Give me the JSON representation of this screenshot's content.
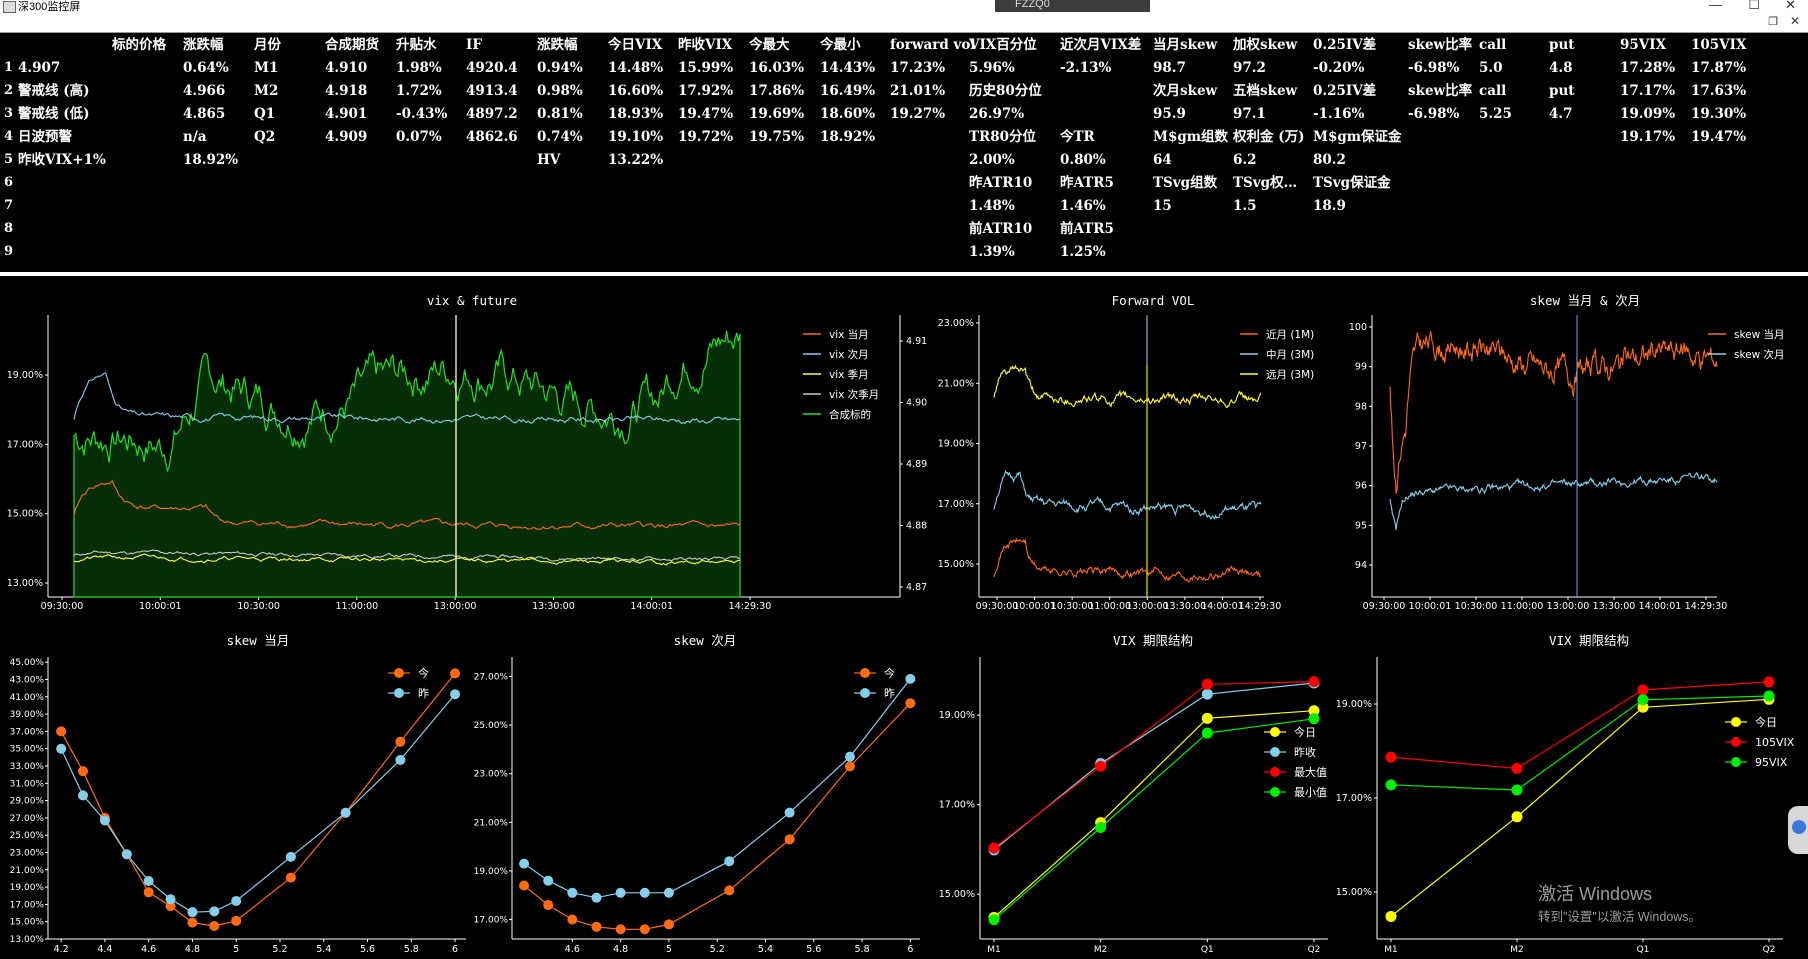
{
  "window": {
    "title": "深300监控屏",
    "ime_text": "FZZQ0"
  },
  "table": {
    "header": [
      "标的价格",
      "涨跌幅",
      "月份",
      "合成期货",
      "升贴水",
      "IF",
      "涨跌幅",
      "今日VIX",
      "昨收VIX",
      "今最大",
      "今最小",
      "forward vol",
      "VIX百分位",
      "近次月VIX差",
      "当月skew",
      "加权skew",
      "0.25IV差",
      "skew比率",
      "call",
      "put",
      "95VIX",
      "105VIX"
    ],
    "row_numbers": [
      "1",
      "2",
      "3",
      "4",
      "5",
      "6",
      "7",
      "8",
      "9"
    ],
    "rows": [
      [
        "4.907",
        "0.64%",
        "M1",
        "4.910",
        "1.98%",
        "4920.4",
        "0.94%",
        "14.48%",
        "15.99%",
        "16.03%",
        "14.43%",
        "17.23%",
        "5.96%",
        "-2.13%",
        "98.7",
        "97.2",
        "-0.20%",
        "-6.98%",
        "5.0",
        "4.8",
        "17.28%",
        "17.87%"
      ],
      [
        "警戒线 (高)",
        "4.966",
        "M2",
        "4.918",
        "1.72%",
        "4913.4",
        "0.98%",
        "16.60%",
        "17.92%",
        "17.86%",
        "16.49%",
        "21.01%",
        "历史80分位",
        "",
        "次月skew",
        "五档skew",
        "0.25IV差",
        "skew比率",
        "call",
        "put",
        "17.17%",
        "17.63%"
      ],
      [
        "警戒线 (低)",
        "4.865",
        "Q1",
        "4.901",
        "-0.43%",
        "4897.2",
        "0.81%",
        "18.93%",
        "19.47%",
        "19.69%",
        "18.60%",
        "19.27%",
        "26.97%",
        "",
        "95.9",
        "97.1",
        "-1.16%",
        "-6.98%",
        "5.25",
        "4.7",
        "19.09%",
        "19.30%"
      ],
      [
        "日波预警",
        "n/a",
        "Q2",
        "4.909",
        "0.07%",
        "4862.6",
        "0.74%",
        "19.10%",
        "19.72%",
        "19.75%",
        "18.92%",
        "",
        "TR80分位",
        "今TR",
        "M$gm组数",
        "权利金 (万)",
        "M$gm保证金",
        "",
        "",
        "",
        "19.17%",
        "19.47%"
      ],
      [
        "昨收VIX+1%",
        "18.92%",
        "",
        "",
        "",
        "",
        "HV",
        "13.22%",
        "",
        "",
        "",
        "",
        "2.00%",
        "0.80%",
        "64",
        "6.2",
        "80.2",
        "",
        "",
        "",
        "",
        ""
      ],
      [
        "",
        "",
        "",
        "",
        "",
        "",
        "",
        "",
        "",
        "",
        "",
        "",
        "昨ATR10",
        "昨ATR5",
        "TSvg组数",
        "TSvg权…",
        "TSvg保证金",
        "",
        "",
        "",
        "",
        ""
      ],
      [
        "",
        "",
        "",
        "",
        "",
        "",
        "",
        "",
        "",
        "",
        "",
        "",
        "1.48%",
        "1.46%",
        "15",
        "1.5",
        "18.9",
        "",
        "",
        "",
        "",
        ""
      ],
      [
        "",
        "",
        "",
        "",
        "",
        "",
        "",
        "",
        "",
        "",
        "",
        "",
        "前ATR10",
        "前ATR5",
        "",
        "",
        "",
        "",
        "",
        "",
        "",
        ""
      ],
      [
        "",
        "",
        "",
        "",
        "",
        "",
        "",
        "",
        "",
        "",
        "",
        "",
        "1.39%",
        "1.25%",
        "",
        "",
        "",
        "",
        "",
        "",
        "",
        ""
      ]
    ]
  },
  "charts": {
    "vix_future": {
      "title": "vix & future",
      "x_ticks": [
        "09:30:00",
        "10:00:01",
        "10:30:00",
        "11:00:00",
        "13:00:00",
        "13:30:00",
        "14:00:01",
        "14:29:30"
      ],
      "y_left_ticks": [
        "19.00%",
        "17.00%",
        "15.00%",
        "13.00%"
      ],
      "y_right_ticks": [
        "4.91",
        "4.90",
        "4.89",
        "4.88",
        "4.87"
      ],
      "legend": [
        {
          "name": "vix 当月",
          "color": "#ff6a13"
        },
        {
          "name": "vix 次月",
          "color": "#87ceeb"
        },
        {
          "name": "vix 季月",
          "color": "#ffff33"
        },
        {
          "name": "vix 次季月",
          "color": "#c8c8c8"
        },
        {
          "name": "合成标的",
          "color": "#22e022"
        }
      ]
    },
    "forward_vol": {
      "title": "Forward VOL",
      "x_ticks": [
        "09:30:00",
        "10:00:01",
        "10:30:00",
        "11:00:00",
        "13:00:00",
        "13:30:00",
        "14:00:01",
        "14:29:30"
      ],
      "y_ticks": [
        "23.00%",
        "21.00%",
        "19.00%",
        "17.00%",
        "15.00%"
      ],
      "legend": [
        {
          "name": "近月 (1M)",
          "color": "#ff6a13"
        },
        {
          "name": "中月 (3M)",
          "color": "#87ceeb"
        },
        {
          "name": "远月 (3M)",
          "color": "#ffff33"
        }
      ]
    },
    "skew_months": {
      "title": "skew 当月 & 次月",
      "x_ticks": [
        "09:30:00",
        "10:00:01",
        "10:30:00",
        "11:00:00",
        "13:00:00",
        "13:30:00",
        "14:00:01",
        "14:29:30"
      ],
      "y_ticks": [
        "100",
        "99",
        "98",
        "97",
        "96",
        "95",
        "94"
      ],
      "legend": [
        {
          "name": "skew 当月",
          "color": "#ff6a13"
        },
        {
          "name": "skew 次月",
          "color": "#87ceeb"
        }
      ]
    },
    "skew_m1": {
      "title": "skew 当月",
      "x": [
        4.2,
        4.3,
        4.4,
        4.5,
        4.6,
        4.7,
        4.8,
        4.9,
        5.0,
        5.25,
        5.5,
        5.75,
        6.0
      ],
      "x_ticks": [
        "4.2",
        "4.4",
        "4.6",
        "4.8",
        "5",
        "5.2",
        "5.4",
        "5.6",
        "5.8",
        "6"
      ],
      "y_ticks": [
        "45.00%",
        "43.00%",
        "41.00%",
        "39.00%",
        "37.00%",
        "35.00%",
        "33.00%",
        "31.00%",
        "29.00%",
        "27.00%",
        "25.00%",
        "23.00%",
        "21.00%",
        "19.00%",
        "17.00%",
        "15.00%",
        "13.00%"
      ],
      "series": [
        {
          "name": "今",
          "color": "#ff6a13",
          "values": [
            37.0,
            32.4,
            27.0,
            22.8,
            18.4,
            16.8,
            14.9,
            14.5,
            15.1,
            20.1,
            27.6,
            35.8,
            43.7
          ]
        },
        {
          "name": "昨",
          "color": "#87ceeb",
          "values": [
            35.0,
            29.6,
            26.7,
            22.8,
            19.7,
            17.6,
            16.1,
            16.2,
            17.4,
            22.5,
            27.6,
            33.7,
            41.3
          ]
        }
      ]
    },
    "skew_m2": {
      "title": "skew 次月",
      "x": [
        4.4,
        4.5,
        4.6,
        4.7,
        4.8,
        4.9,
        5.0,
        5.25,
        5.5,
        5.75,
        6.0
      ],
      "x_ticks": [
        "4.6",
        "4.8",
        "5",
        "5.2",
        "5.4",
        "5.6",
        "5.8",
        "6"
      ],
      "y_ticks": [
        "27.00%",
        "25.00%",
        "23.00%",
        "21.00%",
        "19.00%",
        "17.00%"
      ],
      "series": [
        {
          "name": "今",
          "color": "#ff6a13",
          "values": [
            18.4,
            17.6,
            17.0,
            16.7,
            16.6,
            16.6,
            16.8,
            18.2,
            20.3,
            23.3,
            25.9
          ]
        },
        {
          "name": "昨",
          "color": "#87ceeb",
          "values": [
            19.3,
            18.6,
            18.1,
            17.9,
            18.1,
            18.1,
            18.1,
            19.4,
            21.4,
            23.7,
            26.9
          ]
        }
      ]
    },
    "term_structure_1": {
      "title": "VIX 期限结构",
      "categories": [
        "M1",
        "M2",
        "Q1",
        "Q2"
      ],
      "y_ticks": [
        "19.00%",
        "17.00%",
        "15.00%"
      ],
      "series": [
        {
          "name": "今日",
          "color": "#ffff00",
          "values": [
            14.48,
            16.6,
            18.93,
            19.1
          ]
        },
        {
          "name": "昨收",
          "color": "#87ceeb",
          "values": [
            15.99,
            17.92,
            19.47,
            19.72
          ]
        },
        {
          "name": "最大值",
          "color": "#ff0000",
          "values": [
            16.03,
            17.86,
            19.69,
            19.75
          ]
        },
        {
          "name": "最小值",
          "color": "#00ee00",
          "values": [
            14.43,
            16.49,
            18.6,
            18.92
          ]
        }
      ]
    },
    "term_structure_2": {
      "title": "VIX 期限结构",
      "categories": [
        "M1",
        "M2",
        "Q1",
        "Q2"
      ],
      "y_ticks": [
        "19.00%",
        "17.00%",
        "15.00%"
      ],
      "series": [
        {
          "name": "今日",
          "color": "#ffff00",
          "values": [
            14.48,
            16.6,
            18.93,
            19.1
          ]
        },
        {
          "name": "105VIX",
          "color": "#ff0000",
          "values": [
            17.87,
            17.63,
            19.3,
            19.47
          ]
        },
        {
          "name": "95VIX",
          "color": "#00ee00",
          "values": [
            17.28,
            17.17,
            19.09,
            19.17
          ]
        }
      ]
    }
  },
  "watermark": {
    "line1": "激活 Windows",
    "line2": "转到\"设置\"以激活 Windows。"
  }
}
